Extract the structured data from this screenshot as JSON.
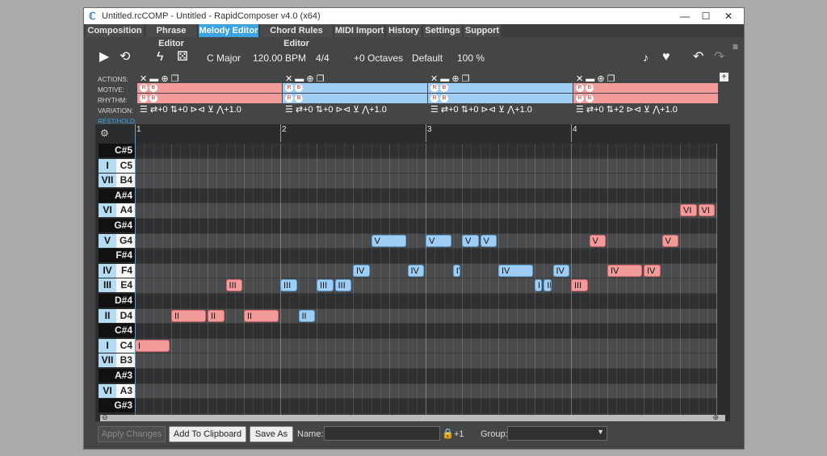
{
  "window": {
    "title": "Untitled.rcCOMP - Untitled - RapidComposer v4.0 (x64)",
    "minimize": "—",
    "maximize": "☐",
    "close": "✕"
  },
  "menu": [
    "Composition",
    "Phrase Editor",
    "Melody Editor",
    "Chord Rules Editor",
    "MIDI Import",
    "History",
    "Settings",
    "Support"
  ],
  "menu_active": "Melody Editor",
  "toolbar": {
    "key": "C Major",
    "tempo": "120.00 BPM",
    "meter": "4/4",
    "octaves": "+0 Octaves",
    "preset": "Default",
    "zoom": "100 %"
  },
  "track_labels": {
    "actions": "ACTIONS:",
    "motive": "MOTIVE:",
    "rhythm": "RHYTHM:",
    "variation": "VARIATION:",
    "rest_hold": "REST/HOLD:"
  },
  "actions_text": "✕ ▬ ⊕ ❐",
  "variations": [
    "☰ ⇄+0 ⇅+0 ⊳⊲ ⊻ ⋀+1.0",
    "☰ ⇄+0 ⇅+0 ⊳⊲ ⊻ ⋀+1.0",
    "☰ ⇄+0 ⇅+0 ⊳⊲ ⊻ ⋀+1.0",
    "☰ ⇄+0 ⇅+2 ⊳⊲ ⊻ ⋀+1.0"
  ],
  "segment_colors": [
    "#f39b9b",
    "#9fcdf4",
    "#9fcdf4",
    "#f39b9b"
  ],
  "bars": [
    "1",
    "2",
    "3",
    "4"
  ],
  "keys": [
    {
      "name": "C#5",
      "degree": ""
    },
    {
      "name": "C5",
      "degree": "I"
    },
    {
      "name": "B4",
      "degree": "VII"
    },
    {
      "name": "A#4",
      "degree": ""
    },
    {
      "name": "A4",
      "degree": "VI"
    },
    {
      "name": "G#4",
      "degree": ""
    },
    {
      "name": "G4",
      "degree": "V"
    },
    {
      "name": "F#4",
      "degree": ""
    },
    {
      "name": "F4",
      "degree": "IV"
    },
    {
      "name": "E4",
      "degree": "III"
    },
    {
      "name": "D#4",
      "degree": ""
    },
    {
      "name": "D4",
      "degree": "II"
    },
    {
      "name": "C#4",
      "degree": ""
    },
    {
      "name": "C4",
      "degree": "I"
    },
    {
      "name": "B3",
      "degree": "VII"
    },
    {
      "name": "A#3",
      "degree": ""
    },
    {
      "name": "A3",
      "degree": "VI"
    },
    {
      "name": "G#3",
      "degree": ""
    }
  ],
  "notes": [
    {
      "label": "I",
      "row": 13,
      "start": 0.0,
      "len": 0.5,
      "color": "red"
    },
    {
      "label": "II",
      "row": 11,
      "start": 0.5,
      "len": 0.5,
      "color": "red"
    },
    {
      "label": "II",
      "row": 11,
      "start": 1.0,
      "len": 0.25,
      "color": "red"
    },
    {
      "label": "III",
      "row": 9,
      "start": 1.25,
      "len": 0.25,
      "color": "red"
    },
    {
      "label": "II",
      "row": 11,
      "start": 1.5,
      "len": 0.5,
      "color": "red"
    },
    {
      "label": "III",
      "row": 9,
      "start": 2.0,
      "len": 0.25,
      "color": "blue"
    },
    {
      "label": "II",
      "row": 11,
      "start": 2.25,
      "len": 0.25,
      "color": "blue"
    },
    {
      "label": "III",
      "row": 9,
      "start": 2.5,
      "len": 0.25,
      "color": "blue"
    },
    {
      "label": "III",
      "row": 9,
      "start": 2.75,
      "len": 0.25,
      "color": "blue"
    },
    {
      "label": "IV",
      "row": 8,
      "start": 3.0,
      "len": 0.25,
      "color": "blue"
    },
    {
      "label": "V",
      "row": 6,
      "start": 3.25,
      "len": 0.5,
      "color": "blue"
    },
    {
      "label": "IV",
      "row": 8,
      "start": 3.75,
      "len": 0.25,
      "color": "blue"
    },
    {
      "label": "V",
      "row": 6,
      "start": 4.0,
      "len": 0.375,
      "color": "blue"
    },
    {
      "label": "IV",
      "row": 8,
      "start": 4.375,
      "len": 0.125,
      "color": "blue"
    },
    {
      "label": "V",
      "row": 6,
      "start": 4.5,
      "len": 0.25,
      "color": "blue"
    },
    {
      "label": "V",
      "row": 6,
      "start": 4.75,
      "len": 0.25,
      "color": "blue"
    },
    {
      "label": "IV",
      "row": 8,
      "start": 5.0,
      "len": 0.5,
      "color": "blue"
    },
    {
      "label": "III",
      "row": 9,
      "start": 5.5,
      "len": 0.125,
      "color": "blue"
    },
    {
      "label": "III",
      "row": 9,
      "start": 5.625,
      "len": 0.125,
      "color": "blue"
    },
    {
      "label": "IV",
      "row": 8,
      "start": 5.75,
      "len": 0.25,
      "color": "blue"
    },
    {
      "label": "III",
      "row": 9,
      "start": 6.0,
      "len": 0.25,
      "color": "red"
    },
    {
      "label": "V",
      "row": 6,
      "start": 6.25,
      "len": 0.25,
      "color": "red"
    },
    {
      "label": "IV",
      "row": 8,
      "start": 6.5,
      "len": 0.5,
      "color": "red"
    },
    {
      "label": "IV",
      "row": 8,
      "start": 7.0,
      "len": 0.25,
      "color": "red"
    },
    {
      "label": "V",
      "row": 6,
      "start": 7.25,
      "len": 0.25,
      "color": "red"
    },
    {
      "label": "VI",
      "row": 4,
      "start": 7.5,
      "len": 0.25,
      "color": "red"
    },
    {
      "label": "VI",
      "row": 4,
      "start": 7.75,
      "len": 0.25,
      "color": "red"
    }
  ],
  "bottom": {
    "apply_changes": "Apply Changes",
    "add_to_clipboard": "Add To Clipboard",
    "save_as": "Save As",
    "name_label": "Name:",
    "name_value": "",
    "plus_one": "+1",
    "group_label": "Group:",
    "group_value": ""
  },
  "colors": {
    "accent": "#3ca3e2",
    "motive_red": "#f39b9b",
    "motive_blue": "#9fcdf4"
  }
}
